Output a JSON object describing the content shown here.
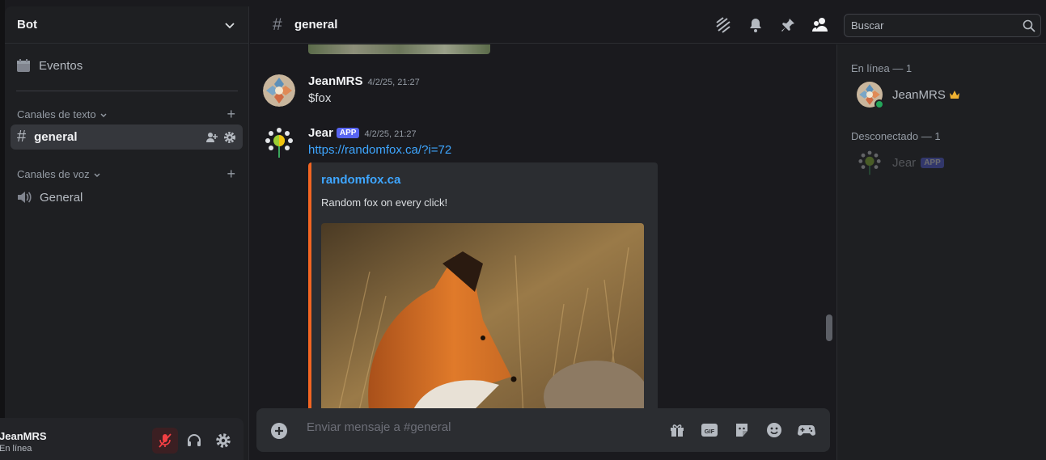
{
  "server": {
    "name": "Bot"
  },
  "sidebar": {
    "events_label": "Eventos",
    "text_category": "Canales de texto",
    "active_channel": "general",
    "voice_category": "Canales de voz",
    "voice_channel": "General"
  },
  "user_panel": {
    "name": "JeanMRS",
    "status": "En línea"
  },
  "topbar": {
    "channel": "general",
    "search_placeholder": "Buscar"
  },
  "messages": [
    {
      "author": "JeanMRS",
      "timestamp": "4/2/25, 21:27",
      "content": "$fox"
    },
    {
      "author": "Jear",
      "badge": "APP",
      "timestamp": "4/2/25, 21:27",
      "content": "https://randomfox.ca/?i=72"
    }
  ],
  "embed": {
    "provider": "randomfox.ca",
    "description": "Random fox on every click!",
    "accent": "#f26522"
  },
  "composer": {
    "placeholder": "Enviar mensaje a #general"
  },
  "members": {
    "online_header": "En línea — 1",
    "offline_header": "Desconectado — 1",
    "online": [
      {
        "name": "JeanMRS",
        "icon": "crown-icon"
      }
    ],
    "offline": [
      {
        "name": "Jear",
        "badge": "APP"
      }
    ]
  },
  "colors": {
    "link": "#3ea6ff",
    "brand": "#5865f2",
    "online": "#23a55a",
    "crown": "#f0b232"
  }
}
